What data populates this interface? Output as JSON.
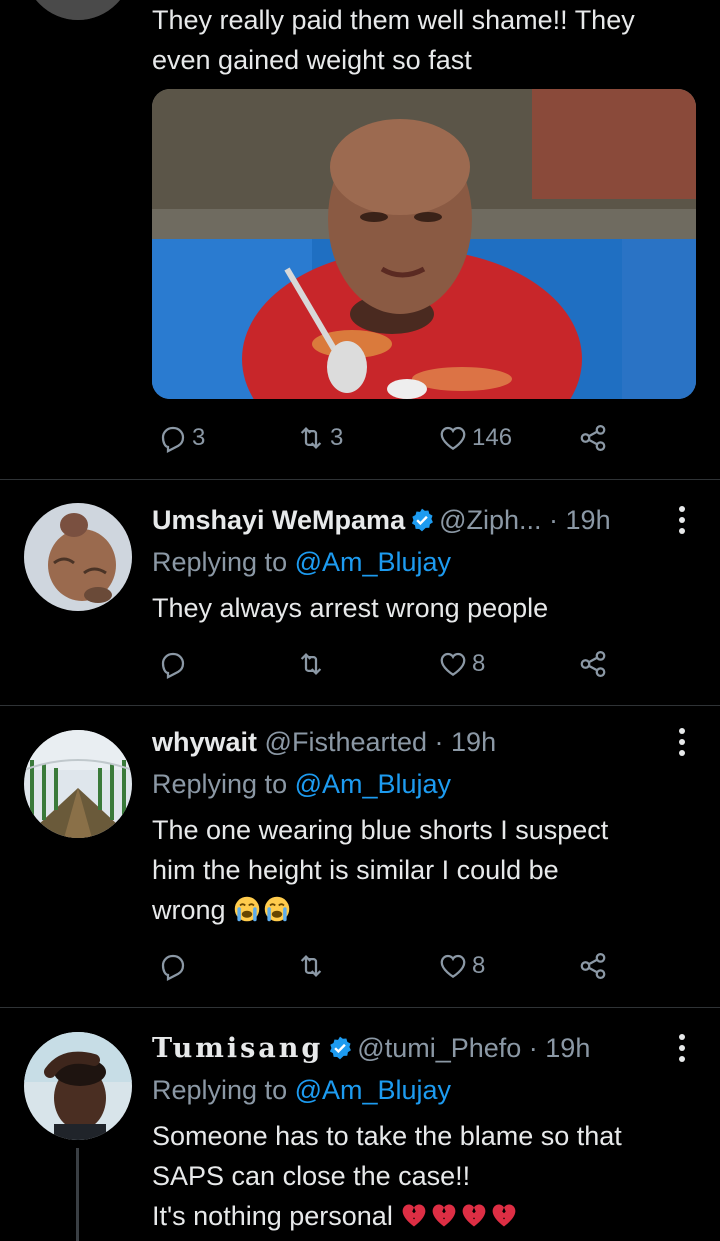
{
  "tweet_top": {
    "text": "They really paid them well shame!! They\neven gained weight so fast",
    "replies": "3",
    "retweets": "3",
    "likes": "146"
  },
  "reply1": {
    "name": "Umshayi WeMpama",
    "handle": "@Ziph...",
    "time": "· 19h",
    "replying_prefix": "Replying to ",
    "replying_to": "@Am_Blujay",
    "text": "They always arrest wrong people",
    "likes": "8"
  },
  "reply2": {
    "name": "whywait",
    "handle": "@Fisthearted",
    "time": "· 19h",
    "replying_prefix": "Replying to ",
    "replying_to": "@Am_Blujay",
    "text": "The one wearing blue shorts I suspect\nhim the height is similar I could be\nwrong",
    "likes": "8"
  },
  "reply3": {
    "name": "Tumisang",
    "handle": "@tumi_Phefo",
    "time": "· 19h",
    "replying_prefix": "Replying to ",
    "replying_to": "@Am_Blujay",
    "text_line1": "Someone has to take the blame so that\nSAPS can close the case!!",
    "text_line2": "It's nothing personal "
  },
  "colors": {
    "background": "#000000",
    "text": "#e7e9ea",
    "muted": "#8b98a5",
    "accent": "#1d9bf0",
    "divider": "#2f3336"
  },
  "icons": [
    "reply-icon",
    "retweet-icon",
    "like-icon",
    "share-icon",
    "verified-badge-icon",
    "more-icon",
    "loudly-crying-face-emoji",
    "broken-heart-emoji"
  ]
}
